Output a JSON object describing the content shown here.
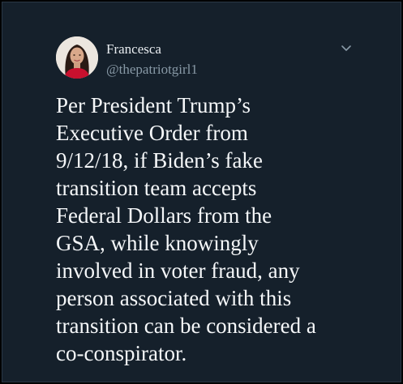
{
  "tweet": {
    "author": {
      "display_name": "Francesca",
      "handle": "@thepatriotgirl1"
    },
    "menu_icon": "chevron-down-icon",
    "text": "Per President Trump’s\nExecutive Order from\n9/12/18, if Biden’s fake\ntransition team accepts\nFederal Dollars from the\nGSA, while knowingly\ninvolved in voter fraud, any\nperson associated with this\ntransition can be considered a\nco-conspirator."
  },
  "colors": {
    "card_background": "#15202b",
    "text": "#f5f7f9",
    "secondary_text": "#8899a6"
  }
}
